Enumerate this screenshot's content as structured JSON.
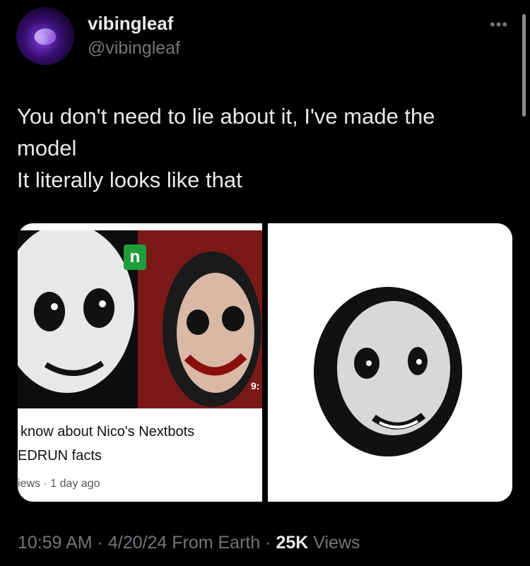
{
  "author": {
    "display_name": "vibingleaf",
    "handle": "@vibingleaf"
  },
  "menu_icon": "more-horizontal-icon",
  "tweet": {
    "lines": [
      "You don't need to lie about it, I've made the",
      "model",
      "It literally looks like that"
    ]
  },
  "media": {
    "left": {
      "logo_letter": "n",
      "duration": "9:",
      "title_line1": "know about Nico's Nextbots",
      "title_line2": "EDRUN facts",
      "meta": "iews · 1 day ago"
    }
  },
  "footer": {
    "time": "10:59 AM",
    "sep1": " · ",
    "date": "4/20/24",
    "source": " From Earth",
    "sep2": " · ",
    "views_count": "25K",
    "views_label": " Views"
  },
  "colors": {
    "background": "#000000",
    "text": "#e7e9ea",
    "muted": "#71767b"
  }
}
